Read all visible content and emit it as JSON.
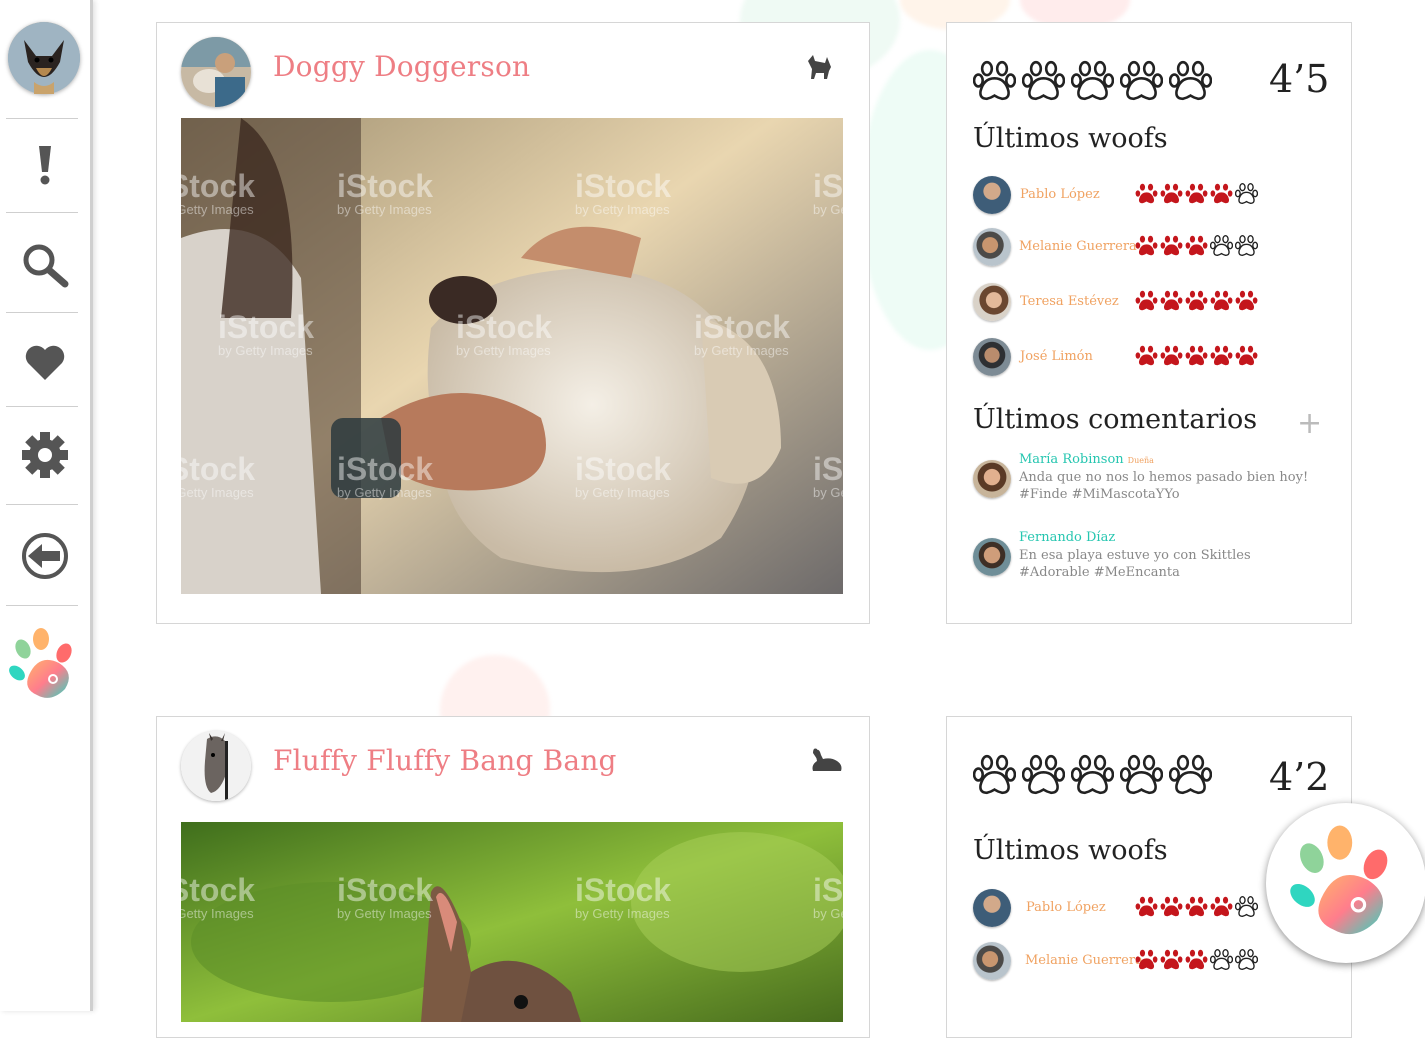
{
  "posts": [
    {
      "name": "Doggy Doggerson",
      "pet_type": "dog-icon",
      "rating": "4’5",
      "woofs_title": "Últimos woofs",
      "woofs": [
        {
          "user": "Pablo López",
          "filled": 4
        },
        {
          "user": "Melanie Guerrera",
          "filled": 3
        },
        {
          "user": "Teresa Estévez",
          "filled": 5
        },
        {
          "user": "José Limón",
          "filled": 5
        }
      ],
      "comments_title": "Últimos comentarios",
      "comments": [
        {
          "user": "María Robinson",
          "tag": "Dueña",
          "text": "Anda que no nos lo hemos pasado bien hoy! #Finde #MiMascotaYYo"
        },
        {
          "user": "Fernando Díaz",
          "tag": "",
          "text": "En esa playa estuve yo con Skittles #Adorable #MeEncanta"
        }
      ],
      "watermark": "iStock",
      "watermark_sub": "by Getty Images"
    },
    {
      "name": "Fluffy Fluffy Bang Bang",
      "pet_type": "rabbit-icon",
      "rating": "4’2",
      "woofs_title": "Últimos woofs",
      "woofs": [
        {
          "user": "Pablo López",
          "filled": 4
        },
        {
          "user": "Melanie Guerrera",
          "filled": 3
        }
      ],
      "watermark": "iStock",
      "watermark_sub": "by Getty Images"
    }
  ],
  "sidebar": {
    "items": [
      "alerts-icon",
      "search-icon",
      "heart-icon",
      "gear-icon",
      "logout-icon",
      "app-logo-icon"
    ]
  },
  "colors": {
    "accent": "#ee7e84",
    "woof_name": "#f0a261",
    "comment_user": "#26c6b0",
    "paw_filled": "#c4161c"
  }
}
